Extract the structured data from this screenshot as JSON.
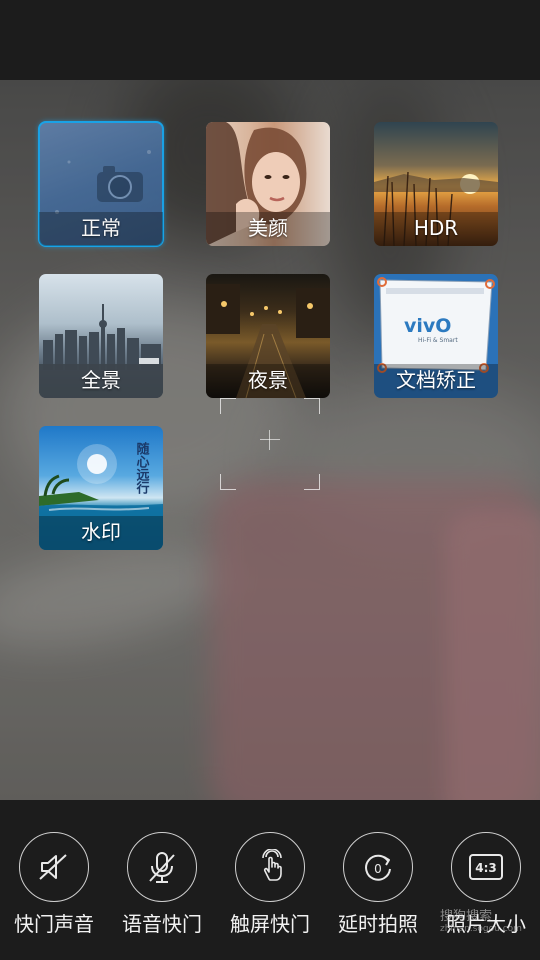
{
  "modes": [
    {
      "id": "normal",
      "label": "正常",
      "selected": true
    },
    {
      "id": "beauty",
      "label": "美颜",
      "selected": false
    },
    {
      "id": "hdr",
      "label": "HDR",
      "selected": false
    },
    {
      "id": "panorama",
      "label": "全景",
      "selected": false
    },
    {
      "id": "night",
      "label": "夜景",
      "selected": false
    },
    {
      "id": "doc",
      "label": "文档矫正",
      "selected": false
    },
    {
      "id": "watermark",
      "label": "水印",
      "selected": false
    }
  ],
  "thumb_text": {
    "doc_brand": "vivO",
    "doc_tagline": "Hi-Fi & Smart",
    "watermark_caption": "随心远行"
  },
  "tools": [
    {
      "label": "快门声音",
      "icon": "speaker-muted-icon"
    },
    {
      "label": "语音快门",
      "icon": "microphone-muted-icon"
    },
    {
      "label": "触屏快门",
      "icon": "touch-hand-icon"
    },
    {
      "label": "延时拍照",
      "icon": "timer-icon",
      "value": "0"
    },
    {
      "label": "照片大小",
      "icon": "aspect-ratio-icon",
      "value": "4:3"
    }
  ],
  "site_watermark": {
    "line1": "搜狗搜索",
    "line2": "zhinan.sogou.com"
  },
  "colors": {
    "selected_outline": "#18a7ef",
    "bar_background": "#1c1c1c"
  }
}
